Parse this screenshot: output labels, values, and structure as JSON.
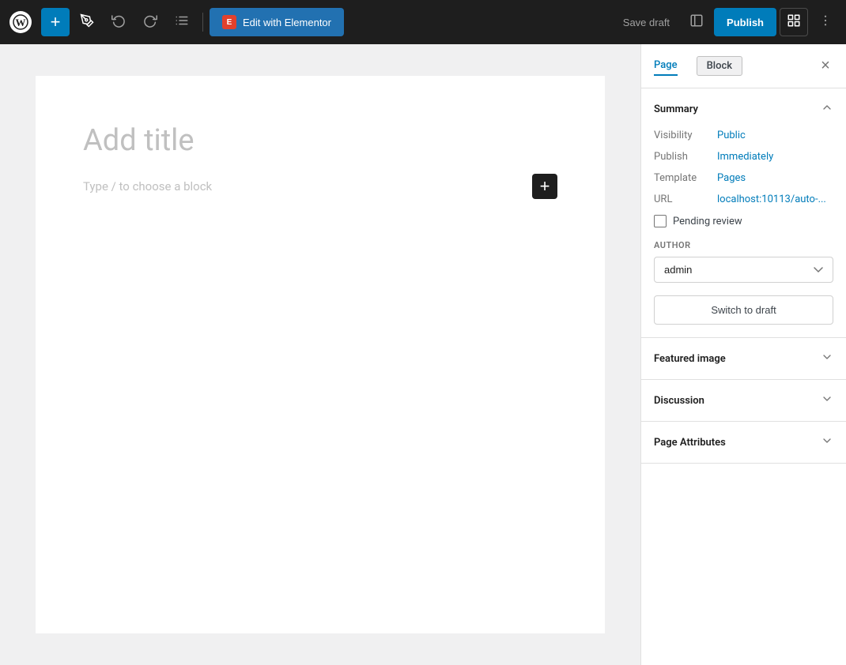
{
  "toolbar": {
    "wp_logo": "W",
    "add_label": "+",
    "edit_with_elementor_label": "Edit with Elementor",
    "elementor_icon_label": "E",
    "save_draft_label": "Save draft",
    "publish_label": "Publish",
    "undo_icon": "↩",
    "redo_icon": "↪",
    "list_icon": "≡",
    "view_icon": "⬜",
    "settings_icon": "▦",
    "three_dots_icon": "⋮"
  },
  "editor": {
    "title_placeholder": "Add title",
    "block_placeholder": "Type / to choose a block",
    "add_block_label": "+"
  },
  "sidebar": {
    "tab_page_label": "Page",
    "tab_block_label": "Block",
    "close_icon": "×",
    "summary": {
      "title": "Summary",
      "collapse_icon": "chevron-up",
      "visibility_label": "Visibility",
      "visibility_value": "Public",
      "publish_label": "Publish",
      "publish_value": "Immediately",
      "template_label": "Template",
      "template_value": "Pages",
      "url_label": "URL",
      "url_value": "localhost:10113/auto-...",
      "pending_review_label": "Pending review",
      "author_label": "AUTHOR",
      "author_value": "admin",
      "author_options": [
        "admin"
      ],
      "switch_draft_label": "Switch to draft"
    },
    "featured_image": {
      "title": "Featured image",
      "chevron_icon": "chevron-down"
    },
    "discussion": {
      "title": "Discussion",
      "chevron_icon": "chevron-down"
    },
    "page_attributes": {
      "title": "Page Attributes",
      "chevron_icon": "chevron-down"
    }
  },
  "colors": {
    "accent_blue": "#007cba",
    "toolbar_bg": "#1e1e1e",
    "elementor_red": "#e2412d"
  }
}
